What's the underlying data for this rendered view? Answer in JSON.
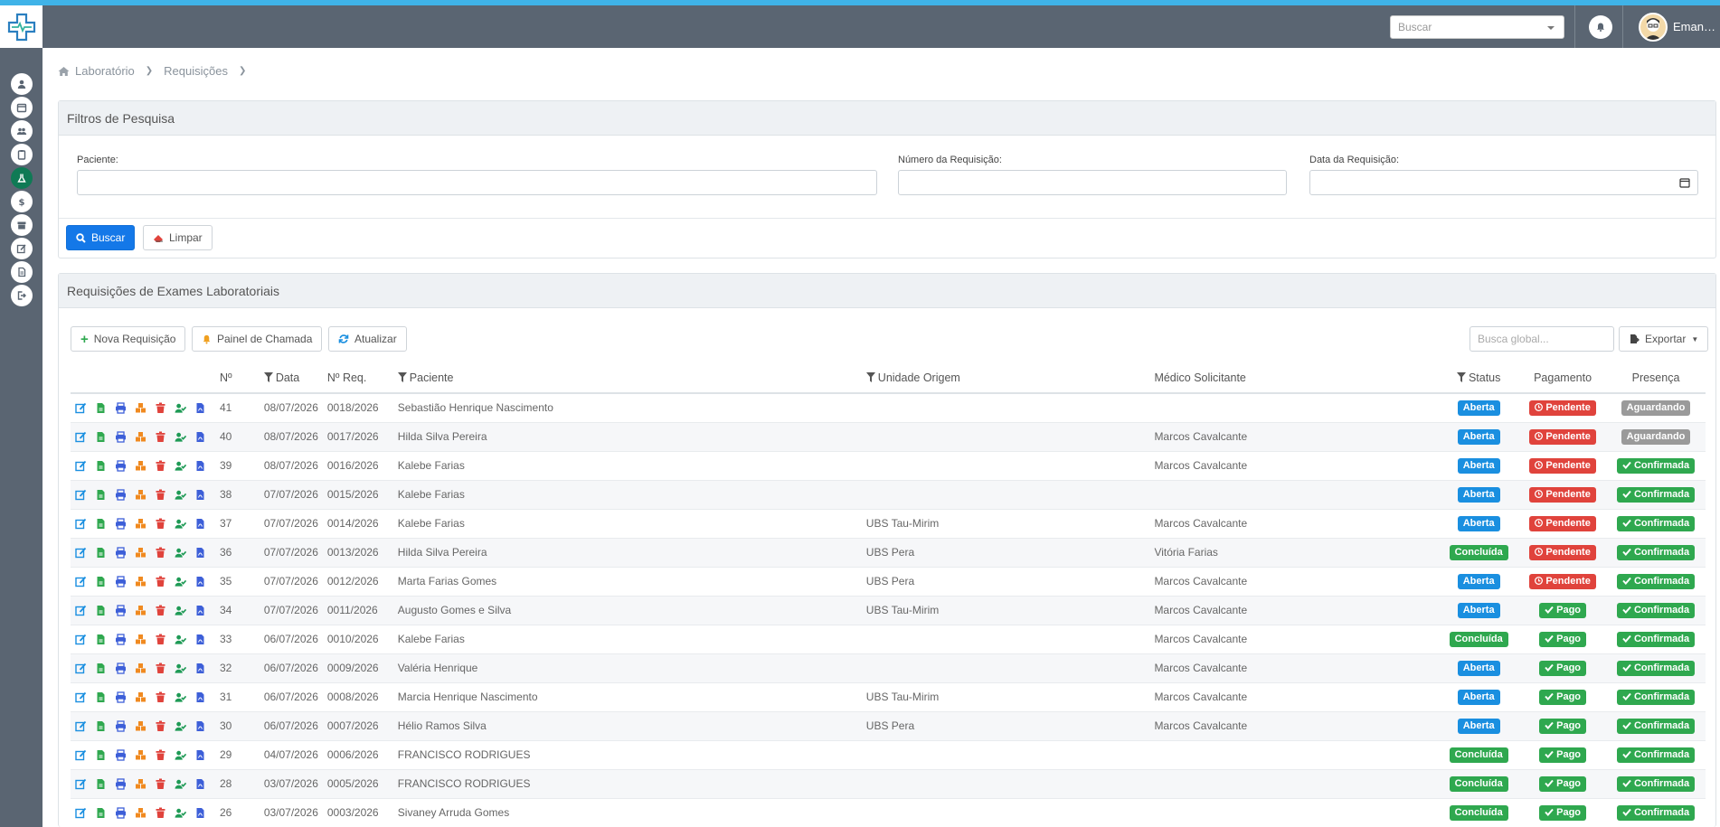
{
  "header": {
    "search_placeholder": "Buscar",
    "user_name": "Emanue..."
  },
  "breadcrumb": [
    "Laboratório",
    "Requisições"
  ],
  "filters": {
    "title": "Filtros de Pesquisa",
    "patient_label": "Paciente:",
    "req_number_label": "Número da Requisição:",
    "req_date_label": "Data da Requisição:",
    "search_button": "Buscar",
    "clear_button": "Limpar"
  },
  "requests": {
    "title": "Requisições de Exames Laboratoriais",
    "new_button": "Nova Requisição",
    "panel_button": "Painel de Chamada",
    "refresh_button": "Atualizar",
    "global_search_placeholder": "Busca global...",
    "export_button": "Exportar",
    "columns": {
      "num": "Nº",
      "date": "Data",
      "req": "Nº Req.",
      "patient": "Paciente",
      "unit": "Unidade Origem",
      "doctor": "Médico Solicitante",
      "status": "Status",
      "payment": "Pagamento",
      "presence": "Presença"
    },
    "rows": [
      {
        "num": "41",
        "date": "08/07/2026",
        "req": "0018/2026",
        "patient": "Sebastião Henrique Nascimento",
        "unit": "",
        "doctor": "",
        "status": "Aberta",
        "payment": "Pendente",
        "presence": "Aguardando"
      },
      {
        "num": "40",
        "date": "08/07/2026",
        "req": "0017/2026",
        "patient": "Hilda Silva Pereira",
        "unit": "",
        "doctor": "Marcos Cavalcante",
        "status": "Aberta",
        "payment": "Pendente",
        "presence": "Aguardando"
      },
      {
        "num": "39",
        "date": "08/07/2026",
        "req": "0016/2026",
        "patient": "Kalebe Farias",
        "unit": "",
        "doctor": "Marcos Cavalcante",
        "status": "Aberta",
        "payment": "Pendente",
        "presence": "Confirmada"
      },
      {
        "num": "38",
        "date": "07/07/2026",
        "req": "0015/2026",
        "patient": "Kalebe Farias",
        "unit": "",
        "doctor": "",
        "status": "Aberta",
        "payment": "Pendente",
        "presence": "Confirmada"
      },
      {
        "num": "37",
        "date": "07/07/2026",
        "req": "0014/2026",
        "patient": "Kalebe Farias",
        "unit": "UBS Tau-Mirim",
        "doctor": "Marcos Cavalcante",
        "status": "Aberta",
        "payment": "Pendente",
        "presence": "Confirmada"
      },
      {
        "num": "36",
        "date": "07/07/2026",
        "req": "0013/2026",
        "patient": "Hilda Silva Pereira",
        "unit": "UBS Pera",
        "doctor": "Vitória Farias",
        "status": "Concluída",
        "payment": "Pendente",
        "presence": "Confirmada"
      },
      {
        "num": "35",
        "date": "07/07/2026",
        "req": "0012/2026",
        "patient": "Marta Farias Gomes",
        "unit": "UBS Pera",
        "doctor": "Marcos Cavalcante",
        "status": "Aberta",
        "payment": "Pendente",
        "presence": "Confirmada"
      },
      {
        "num": "34",
        "date": "07/07/2026",
        "req": "0011/2026",
        "patient": "Augusto Gomes e Silva",
        "unit": "UBS Tau-Mirim",
        "doctor": "Marcos Cavalcante",
        "status": "Aberta",
        "payment": "Pago",
        "presence": "Confirmada"
      },
      {
        "num": "33",
        "date": "06/07/2026",
        "req": "0010/2026",
        "patient": "Kalebe Farias",
        "unit": "",
        "doctor": "Marcos Cavalcante",
        "status": "Concluída",
        "payment": "Pago",
        "presence": "Confirmada"
      },
      {
        "num": "32",
        "date": "06/07/2026",
        "req": "0009/2026",
        "patient": "Valéria Henrique",
        "unit": "",
        "doctor": "Marcos Cavalcante",
        "status": "Aberta",
        "payment": "Pago",
        "presence": "Confirmada"
      },
      {
        "num": "31",
        "date": "06/07/2026",
        "req": "0008/2026",
        "patient": "Marcia Henrique Nascimento",
        "unit": "UBS Tau-Mirim",
        "doctor": "Marcos Cavalcante",
        "status": "Aberta",
        "payment": "Pago",
        "presence": "Confirmada"
      },
      {
        "num": "30",
        "date": "06/07/2026",
        "req": "0007/2026",
        "patient": "Hélio Ramos Silva",
        "unit": "UBS Pera",
        "doctor": "Marcos Cavalcante",
        "status": "Aberta",
        "payment": "Pago",
        "presence": "Confirmada"
      },
      {
        "num": "29",
        "date": "04/07/2026",
        "req": "0006/2026",
        "patient": "FRANCISCO RODRIGUES",
        "unit": "",
        "doctor": "",
        "status": "Concluída",
        "payment": "Pago",
        "presence": "Confirmada"
      },
      {
        "num": "28",
        "date": "03/07/2026",
        "req": "0005/2026",
        "patient": "FRANCISCO RODRIGUES",
        "unit": "",
        "doctor": "",
        "status": "Concluída",
        "payment": "Pago",
        "presence": "Confirmada"
      },
      {
        "num": "26",
        "date": "03/07/2026",
        "req": "0003/2026",
        "patient": "Sivaney Arruda Gomes",
        "unit": "",
        "doctor": "",
        "status": "Concluída",
        "payment": "Pago",
        "presence": "Confirmada"
      }
    ]
  },
  "colors": {
    "sidebar": "#5a6572",
    "accent_top": "#3fb3e8",
    "primary": "#1478e8",
    "badge_blue": "#1a8fe0",
    "badge_green": "#2fa84f",
    "badge_red": "#e0433c",
    "badge_gray": "#9a9a9a"
  }
}
